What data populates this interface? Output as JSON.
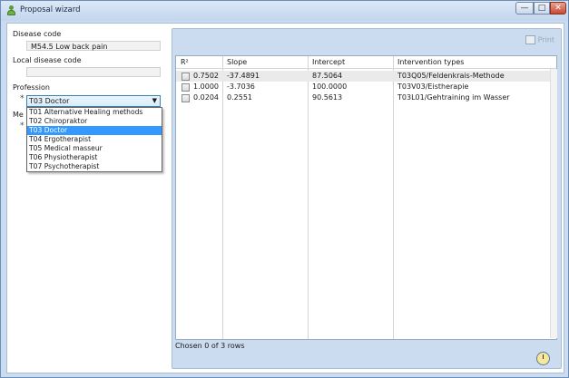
{
  "window": {
    "title": "Proposal wizard",
    "min_label": "—",
    "max_label": "□",
    "close_label": "✕"
  },
  "left": {
    "disease_code_label": "Disease code",
    "disease_code_value": "M54.5 Low back pain",
    "local_code_label": "Local disease code",
    "local_code_value": "",
    "profession_label": "Profession",
    "required_marker": "*",
    "profession_selected": "T03 Doctor",
    "covered_label_fragment": "Me",
    "second_required_marker": "*",
    "options": [
      "T01 Alternative Healing methods",
      "T02 Chiropraktor",
      "T03 Doctor",
      "T04 Ergotherapist",
      "T05 Medical masseur",
      "T06 Physiotherapist",
      "T07 Psychotherapist"
    ],
    "selected_index": 2
  },
  "toolbar": {
    "print_label": "Print"
  },
  "table": {
    "columns": [
      "R²",
      "Slope",
      "Intercept",
      "Intervention types"
    ],
    "rows": [
      {
        "r2": "0.7502",
        "slope": "-37.4891",
        "intercept": "87.5064",
        "type": "T03Q05/Feldenkrais-Methode",
        "checked": false
      },
      {
        "r2": "1.0000",
        "slope": "-3.7036",
        "intercept": "100.0000",
        "type": "T03V03/Eistherapie",
        "checked": false
      },
      {
        "r2": "0.0204",
        "slope": "0.2551",
        "intercept": "90.5613",
        "type": "T03L01/Gehtraining im Wasser",
        "checked": false
      }
    ],
    "status": "Chosen 0 of 3 rows"
  },
  "colors": {
    "accent": "#3399ff",
    "frame": "#cbdcf0"
  },
  "icons": [
    "user-icon",
    "print-icon",
    "checkbox-icon",
    "clock-icon",
    "dropdown-arrow-icon"
  ]
}
